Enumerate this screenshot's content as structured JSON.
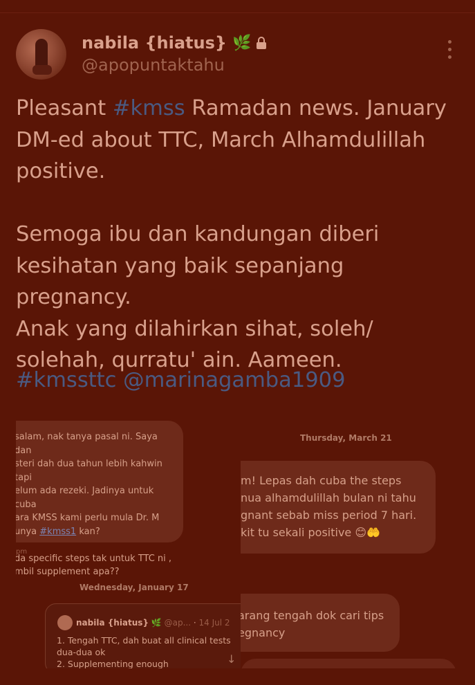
{
  "author": {
    "name": "nabila {hiatus}",
    "handle": "@apopuntaktahu",
    "emoji": "🌿"
  },
  "tweet": {
    "line1_pre": "Pleasant ",
    "line1_tag": "#kmss",
    "line1_post": " Ramadan news. January\nDM-ed about TTC, March Alhamdulillah\npositive.\n\nSemoga ibu dan kandungan diberi\nkesihatan yang baik sepanjang pregnancy.\nAnak yang dilahirkan sihat, soleh/\nsolehah, qurratu' ain. Aameen.",
    "hashtag": "#kmssttc",
    "mention": "@marinagamba1909"
  },
  "left_screenshot": {
    "message_text_pre": "salam, nak tanya pasal ni. Saya dan\nsteri dah dua tahun lebih kahwin tapi\nelum ada rezeki. Jadinya untuk cuba\nara KMSS kami perlu mula Dr. M\nunya ",
    "message_link": "#kmss1",
    "message_text_post": " kan?\n\nda specific steps tak untuk TTC ni ,\nmbil supplement apa??",
    "time": "pm",
    "date": "Wednesday, January 17",
    "quote": {
      "name": "nabila {hiatus}",
      "handle": "@ap...",
      "date": "14 Jul 2",
      "text": "1. Tengah TTC, dah buat all clinical tests\ndua-dua ok\n2. Supplementing enough"
    }
  },
  "right_screenshot": {
    "date": "Thursday, March 21",
    "message1": "m! Lepas dah cuba the steps\nnua alhamdulillah bulan ni tahu\ngnant sebab miss period 7 hari.\n kit tu sekali positive 😊🤲",
    "message2": "arang tengah dok cari tips\negnancy"
  },
  "colors": {
    "background": "#5a1506",
    "text": "#d9a08c",
    "link": "#4a5a82",
    "bubble": "#6e2a1a"
  }
}
